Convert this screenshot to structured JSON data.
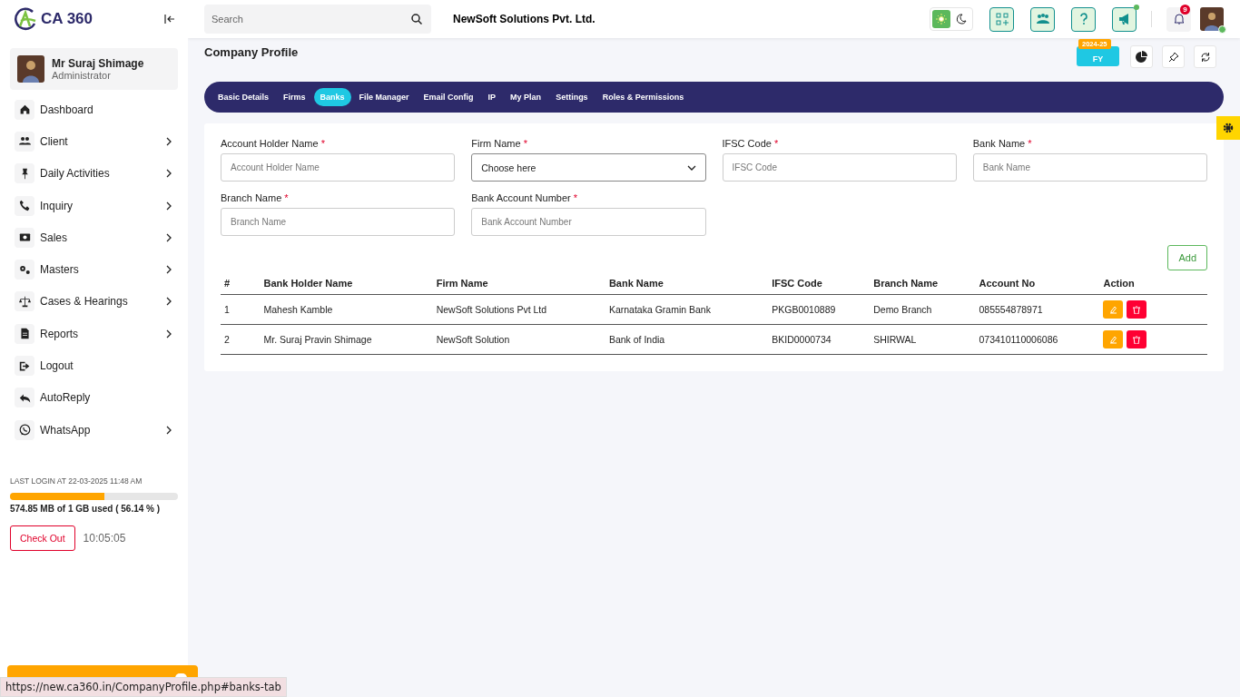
{
  "sidebar": {
    "logo": "CA 360",
    "user": {
      "name": "Mr Suraj Shimage",
      "role": "Administrator"
    },
    "items": [
      {
        "label": "Dashboard",
        "expandable": false
      },
      {
        "label": "Client",
        "expandable": true
      },
      {
        "label": "Daily Activities",
        "expandable": true
      },
      {
        "label": "Inquiry",
        "expandable": true
      },
      {
        "label": "Sales",
        "expandable": true
      },
      {
        "label": "Masters",
        "expandable": true
      },
      {
        "label": "Cases & Hearings",
        "expandable": true
      },
      {
        "label": "Reports",
        "expandable": true
      },
      {
        "label": "Logout",
        "expandable": false
      },
      {
        "label": "AutoReply",
        "expandable": false
      },
      {
        "label": "WhatsApp",
        "expandable": true
      }
    ],
    "last_login": "LAST LOGIN AT 22-03-2025 11:48 AM",
    "storage": {
      "level": 0.5614,
      "text": "574.85 MB of 1 GB used ( 56.14 % )"
    },
    "checkout": "Check Out",
    "timer": "10:05:05"
  },
  "header": {
    "search": {
      "placeholder": "Search"
    },
    "company": "NewSoft Solutions Pvt. Ltd.",
    "light_mode": true,
    "notifications": "9"
  },
  "page": {
    "title": "Company Profile",
    "fy_badge": "2024-25",
    "fy_label": "FY",
    "tabs": [
      {
        "label": "Basic Details",
        "selected": false
      },
      {
        "label": "Firms",
        "selected": false
      },
      {
        "label": "Banks",
        "selected": true
      },
      {
        "label": "File Manager",
        "selected": false
      },
      {
        "label": "Email Config",
        "selected": false
      },
      {
        "label": "IP",
        "selected": false
      },
      {
        "label": "My Plan",
        "selected": false
      },
      {
        "label": "Settings",
        "selected": false
      },
      {
        "label": "Roles & Permissions",
        "selected": false
      }
    ],
    "fields": [
      {
        "label": "Account Holder Name",
        "required": "*",
        "kind": "text",
        "placeholder": "Account Holder Name"
      },
      {
        "label": "Firm Name",
        "required": "*",
        "kind": "select",
        "value": "Choose here"
      },
      {
        "label": "IFSC Code",
        "required": "*",
        "kind": "text",
        "placeholder": "IFSC Code"
      },
      {
        "label": "Bank Name",
        "required": "*",
        "kind": "text",
        "placeholder": "Bank Name"
      },
      {
        "label": "Branch Name",
        "required": "*",
        "kind": "text",
        "placeholder": "Branch Name"
      },
      {
        "label": "Bank Account Number",
        "required": "*",
        "kind": "text",
        "placeholder": "Bank Account Number"
      }
    ],
    "add_button": "Add",
    "table": {
      "columns": [
        "#",
        "Bank Holder Name",
        "Firm Name",
        "Bank Name",
        "IFSC Code",
        "Branch Name",
        "Account No",
        "Action"
      ],
      "rows": [
        [
          "1",
          "Mahesh Kamble",
          "NewSoft Solutions Pvt Ltd",
          "Karnataka Gramin Bank",
          "PKGB0010889",
          "Demo Branch",
          "085554878971"
        ],
        [
          "2",
          "Mr. Suraj Pravin Shimage",
          "NewSoft Solution",
          "Bank of India",
          "BKID0000734",
          "SHIRWAL",
          "073410110006086"
        ]
      ]
    }
  },
  "status_url": "https://new.ca360.in/CompanyProfile.php#banks-tab"
}
